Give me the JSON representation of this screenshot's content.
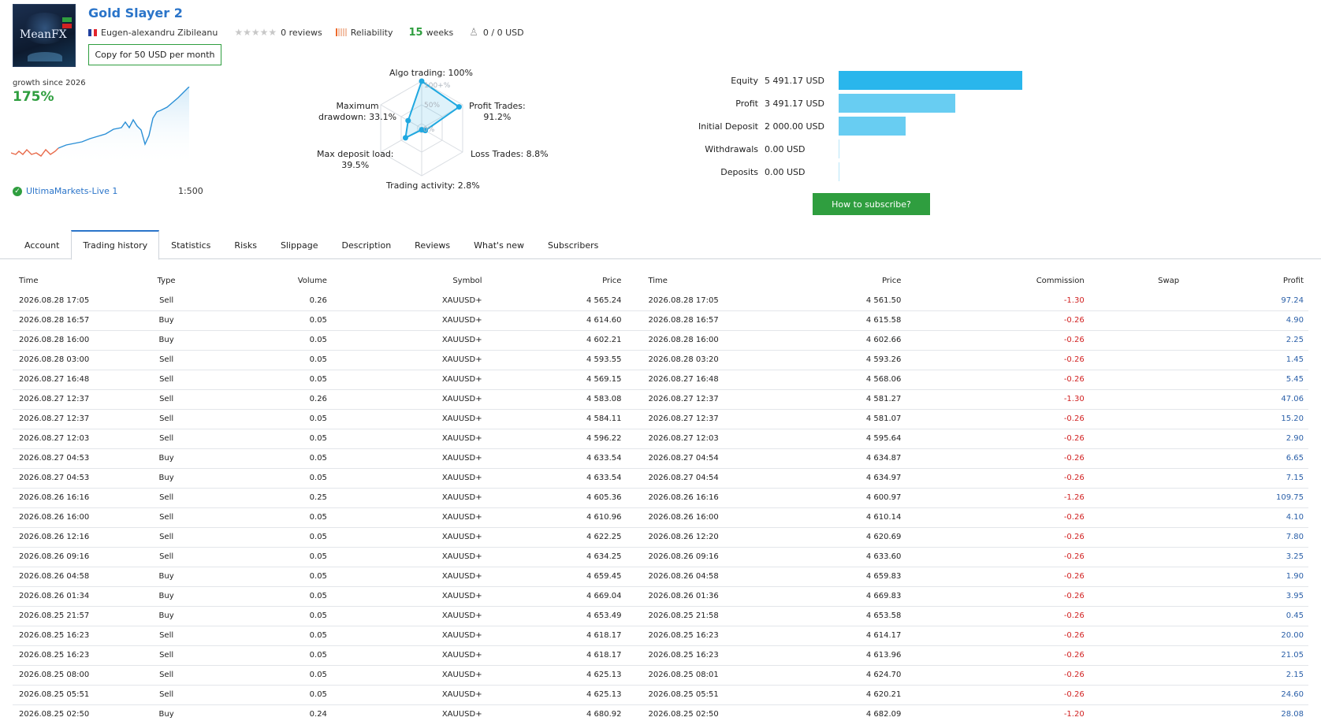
{
  "header": {
    "logo_text": "MeanFX",
    "title": "Gold Slayer 2",
    "author": "Eugen-alexandru Zibileanu",
    "stars": "★★★★★",
    "reviews": "0 reviews",
    "reliability_label": "Reliability",
    "weeks_value": "15",
    "weeks_label": "weeks",
    "subscribers": "0 / 0 USD",
    "copy_button": "Copy for 50 USD per month"
  },
  "growth": {
    "label": "growth since 2026",
    "value": "175%",
    "broker": "UltimaMarkets-Live 1",
    "leverage": "1:500"
  },
  "radar": {
    "algo": "Algo trading: 100%",
    "profit_trades_1": "Profit Trades:",
    "profit_trades_2": "91.2%",
    "loss_trades": "Loss Trades: 8.8%",
    "trading_activity": "Trading activity: 2.8%",
    "max_deposit_1": "Max deposit load:",
    "max_deposit_2": "39.5%",
    "max_dd_1": "Maximum",
    "max_dd_2": "drawdown: 33.1%",
    "tick_100": "100+%",
    "tick_50": "50%",
    "tick_0": "0%",
    "values": {
      "algo": 100,
      "profit_trades": 91.2,
      "loss_trades": 8.8,
      "trading_activity": 2.8,
      "max_deposit_load": 39.5,
      "max_drawdown": 33.1
    }
  },
  "account_bars": {
    "rows": [
      {
        "label": "Equity",
        "value": "5 491.17 USD",
        "amount": 5491.17,
        "color": "#29b6ec"
      },
      {
        "label": "Profit",
        "value": "3 491.17 USD",
        "amount": 3491.17,
        "color": "#68cdf2"
      },
      {
        "label": "Initial Deposit",
        "value": "2 000.00 USD",
        "amount": 2000.0,
        "color": "#68cdf2"
      },
      {
        "label": "Withdrawals",
        "value": "0.00 USD",
        "amount": 0,
        "color": "#68cdf2"
      },
      {
        "label": "Deposits",
        "value": "0.00 USD",
        "amount": 0,
        "color": "#68cdf2"
      }
    ],
    "subscribe_button": "How to subscribe?"
  },
  "tabs": [
    {
      "label": "Account",
      "active": false
    },
    {
      "label": "Trading history",
      "active": true
    },
    {
      "label": "Statistics",
      "active": false
    },
    {
      "label": "Risks",
      "active": false
    },
    {
      "label": "Slippage",
      "active": false
    },
    {
      "label": "Description",
      "active": false
    },
    {
      "label": "Reviews",
      "active": false
    },
    {
      "label": "What's new",
      "active": false
    },
    {
      "label": "Subscribers",
      "active": false
    }
  ],
  "table": {
    "columns": [
      "Time",
      "Type",
      "Volume",
      "Symbol",
      "Price",
      "Time",
      "Price",
      "Commission",
      "Swap",
      "Profit"
    ],
    "rows": [
      [
        "2026.08.28 17:05",
        "Sell",
        "0.26",
        "XAUUSD+",
        "4 565.24",
        "2026.08.28 17:05",
        "4 561.50",
        "-1.30",
        "",
        "97.24"
      ],
      [
        "2026.08.28 16:57",
        "Buy",
        "0.05",
        "XAUUSD+",
        "4 614.60",
        "2026.08.28 16:57",
        "4 615.58",
        "-0.26",
        "",
        "4.90"
      ],
      [
        "2026.08.28 16:00",
        "Buy",
        "0.05",
        "XAUUSD+",
        "4 602.21",
        "2026.08.28 16:00",
        "4 602.66",
        "-0.26",
        "",
        "2.25"
      ],
      [
        "2026.08.28 03:00",
        "Sell",
        "0.05",
        "XAUUSD+",
        "4 593.55",
        "2026.08.28 03:20",
        "4 593.26",
        "-0.26",
        "",
        "1.45"
      ],
      [
        "2026.08.27 16:48",
        "Sell",
        "0.05",
        "XAUUSD+",
        "4 569.15",
        "2026.08.27 16:48",
        "4 568.06",
        "-0.26",
        "",
        "5.45"
      ],
      [
        "2026.08.27 12:37",
        "Sell",
        "0.26",
        "XAUUSD+",
        "4 583.08",
        "2026.08.27 12:37",
        "4 581.27",
        "-1.30",
        "",
        "47.06"
      ],
      [
        "2026.08.27 12:37",
        "Sell",
        "0.05",
        "XAUUSD+",
        "4 584.11",
        "2026.08.27 12:37",
        "4 581.07",
        "-0.26",
        "",
        "15.20"
      ],
      [
        "2026.08.27 12:03",
        "Sell",
        "0.05",
        "XAUUSD+",
        "4 596.22",
        "2026.08.27 12:03",
        "4 595.64",
        "-0.26",
        "",
        "2.90"
      ],
      [
        "2026.08.27 04:53",
        "Buy",
        "0.05",
        "XAUUSD+",
        "4 633.54",
        "2026.08.27 04:54",
        "4 634.87",
        "-0.26",
        "",
        "6.65"
      ],
      [
        "2026.08.27 04:53",
        "Buy",
        "0.05",
        "XAUUSD+",
        "4 633.54",
        "2026.08.27 04:54",
        "4 634.97",
        "-0.26",
        "",
        "7.15"
      ],
      [
        "2026.08.26 16:16",
        "Sell",
        "0.25",
        "XAUUSD+",
        "4 605.36",
        "2026.08.26 16:16",
        "4 600.97",
        "-1.26",
        "",
        "109.75"
      ],
      [
        "2026.08.26 16:00",
        "Sell",
        "0.05",
        "XAUUSD+",
        "4 610.96",
        "2026.08.26 16:00",
        "4 610.14",
        "-0.26",
        "",
        "4.10"
      ],
      [
        "2026.08.26 12:16",
        "Sell",
        "0.05",
        "XAUUSD+",
        "4 622.25",
        "2026.08.26 12:20",
        "4 620.69",
        "-0.26",
        "",
        "7.80"
      ],
      [
        "2026.08.26 09:16",
        "Sell",
        "0.05",
        "XAUUSD+",
        "4 634.25",
        "2026.08.26 09:16",
        "4 633.60",
        "-0.26",
        "",
        "3.25"
      ],
      [
        "2026.08.26 04:58",
        "Buy",
        "0.05",
        "XAUUSD+",
        "4 659.45",
        "2026.08.26 04:58",
        "4 659.83",
        "-0.26",
        "",
        "1.90"
      ],
      [
        "2026.08.26 01:34",
        "Buy",
        "0.05",
        "XAUUSD+",
        "4 669.04",
        "2026.08.26 01:36",
        "4 669.83",
        "-0.26",
        "",
        "3.95"
      ],
      [
        "2026.08.25 21:57",
        "Buy",
        "0.05",
        "XAUUSD+",
        "4 653.49",
        "2026.08.25 21:58",
        "4 653.58",
        "-0.26",
        "",
        "0.45"
      ],
      [
        "2026.08.25 16:23",
        "Sell",
        "0.05",
        "XAUUSD+",
        "4 618.17",
        "2026.08.25 16:23",
        "4 614.17",
        "-0.26",
        "",
        "20.00"
      ],
      [
        "2026.08.25 16:23",
        "Sell",
        "0.05",
        "XAUUSD+",
        "4 618.17",
        "2026.08.25 16:23",
        "4 613.96",
        "-0.26",
        "",
        "21.05"
      ],
      [
        "2026.08.25 08:00",
        "Sell",
        "0.05",
        "XAUUSD+",
        "4 625.13",
        "2026.08.25 08:01",
        "4 624.70",
        "-0.26",
        "",
        "2.15"
      ],
      [
        "2026.08.25 05:51",
        "Sell",
        "0.05",
        "XAUUSD+",
        "4 625.13",
        "2026.08.25 05:51",
        "4 620.21",
        "-0.26",
        "",
        "24.60"
      ],
      [
        "2026.08.25 02:50",
        "Buy",
        "0.24",
        "XAUUSD+",
        "4 680.92",
        "2026.08.25 02:50",
        "4 682.09",
        "-1.20",
        "",
        "28.08"
      ]
    ]
  },
  "colors": {
    "accent_blue": "#2a74c9",
    "green": "#2f9e3f",
    "commission_red": "#d12222",
    "profit_blue": "#2a5fa8",
    "radar_line": "#1fa8e0"
  }
}
